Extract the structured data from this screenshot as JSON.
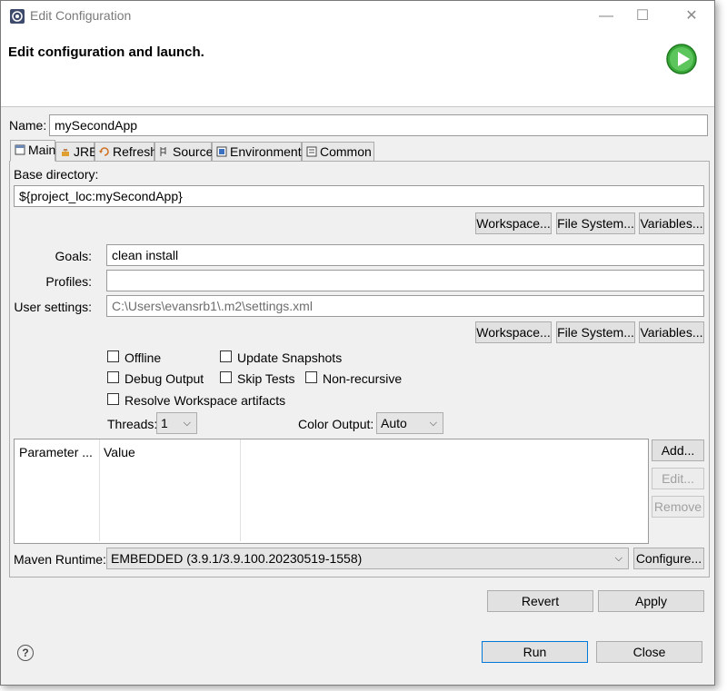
{
  "window": {
    "title": "Edit Configuration",
    "controls": {
      "minimize": "—",
      "maximize": "☐",
      "close": "✕"
    }
  },
  "banner": {
    "title": "Edit configuration and launch.",
    "icon": "run-icon",
    "accent": "#3aa83a"
  },
  "name": {
    "label": "Name:",
    "value": "mySecondApp"
  },
  "tabs": [
    {
      "label": "Main",
      "icon": "main-tab-icon",
      "active": true
    },
    {
      "label": "JRE",
      "icon": "jre-icon"
    },
    {
      "label": "Refresh",
      "icon": "refresh-icon"
    },
    {
      "label": "Source",
      "icon": "source-icon"
    },
    {
      "label": "Environment",
      "icon": "environment-icon"
    },
    {
      "label": "Common",
      "icon": "common-icon"
    }
  ],
  "main": {
    "base_dir_label": "Base directory:",
    "base_dir_value": "${project_loc:mySecondApp}",
    "buttons1": {
      "workspace": "Workspace...",
      "filesystem": "File System...",
      "variables": "Variables..."
    },
    "goals_label": "Goals:",
    "goals_value": "clean install",
    "profiles_label": "Profiles:",
    "profiles_value": "",
    "user_settings_label": "User settings:",
    "user_settings_placeholder": "C:\\Users\\evansrb1\\.m2\\settings.xml",
    "buttons2": {
      "workspace": "Workspace...",
      "filesystem": "File System...",
      "variables": "Variables..."
    },
    "checkboxes": {
      "offline": "Offline",
      "update_snapshots": "Update Snapshots",
      "debug_output": "Debug Output",
      "skip_tests": "Skip Tests",
      "non_recursive": "Non-recursive",
      "resolve_workspace": "Resolve Workspace artifacts"
    },
    "threads_label": "Threads:",
    "threads_value": "1",
    "color_output_label": "Color Output:",
    "color_output_value": "Auto",
    "params_table": {
      "columns": [
        "Parameter ...",
        "Value"
      ],
      "rows": []
    },
    "param_buttons": {
      "add": "Add...",
      "edit": "Edit...",
      "remove": "Remove"
    },
    "maven_runtime_label": "Maven Runtime:",
    "maven_runtime_value": "EMBEDDED (3.9.1/3.9.100.20230519-1558)",
    "configure": "Configure..."
  },
  "actions": {
    "revert": "Revert",
    "apply": "Apply"
  },
  "footer": {
    "help": "?",
    "run": "Run",
    "close": "Close"
  }
}
